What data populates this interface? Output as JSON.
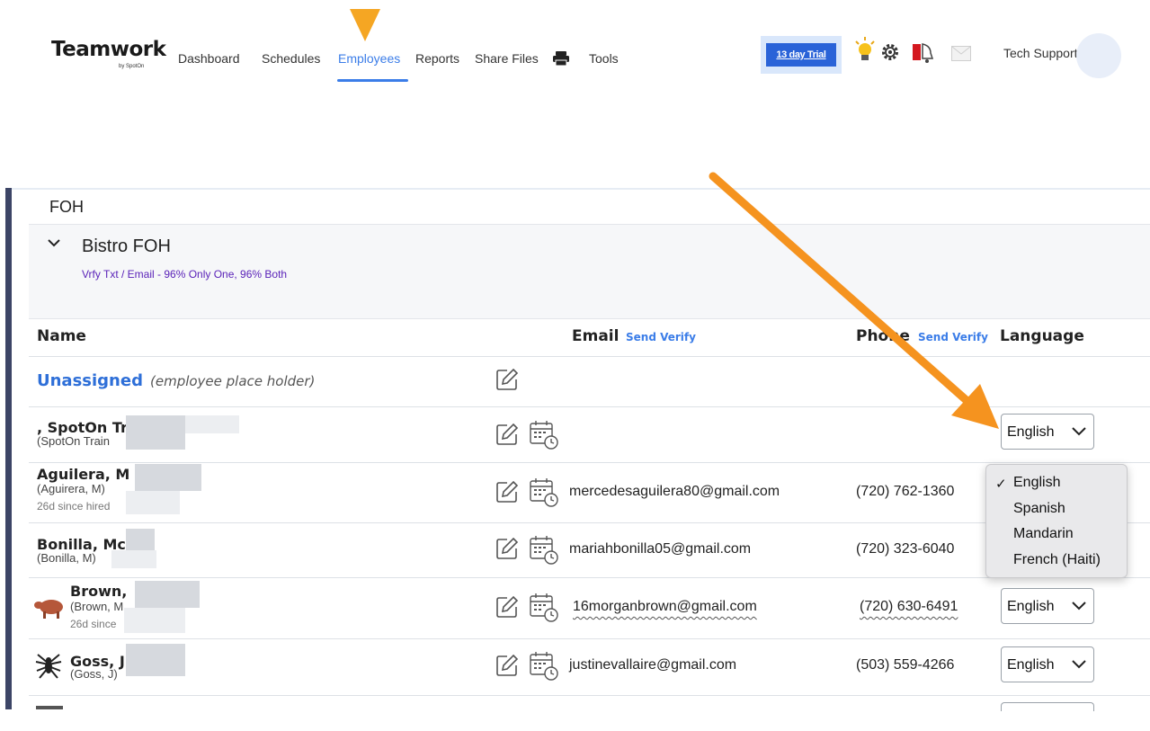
{
  "nav": {
    "logo_text": "Teamwork",
    "logo_sub": "by SpotOn",
    "links": [
      "Dashboard",
      "Schedules",
      "Employees",
      "Reports",
      "Share Files",
      "Tools"
    ],
    "active": "Employees",
    "trial_label": "13 day Trial",
    "support_label": "Tech Support"
  },
  "section": {
    "title": "FOH",
    "group_name": "Bistro FOH",
    "verify_summary": "Vrfy Txt / Email - 96% Only One, 96% Both"
  },
  "table": {
    "headers": {
      "name": "Name",
      "email": "Email",
      "email_action": "Send Verify",
      "phone": "Phone",
      "phone_action": "Send Verify",
      "language": "Language"
    },
    "unassigned": {
      "label": "Unassigned",
      "note": "(employee place holder)"
    },
    "rows": [
      {
        "name": ", SpotOn Tr",
        "sub": "(SpotOn Train",
        "hired": "",
        "email": "",
        "phone": "",
        "language": "English"
      },
      {
        "name": "Aguilera, M",
        "sub": "(Aguirera, M)",
        "hired": "26d since hired",
        "email": "mercedesaguilera80@gmail.com",
        "phone": "(720) 762-1360",
        "language": "English"
      },
      {
        "name": "Bonilla, Mc",
        "sub": "(Bonilla, M)",
        "hired": "",
        "email": "mariahbonilla05@gmail.com",
        "phone": "(720) 323-6040",
        "language": ""
      },
      {
        "name": "Brown,",
        "sub": "(Brown, M",
        "hired": "26d since",
        "email": "16morganbrown@gmail.com",
        "phone": "(720) 630-6491",
        "language": "English"
      },
      {
        "name": "Goss, J",
        "sub": "(Goss, J)",
        "hired": "",
        "email": "justinevallaire@gmail.com",
        "phone": "(503) 559-4266",
        "language": "English"
      }
    ]
  },
  "language_dropdown": {
    "selected": "English",
    "options": [
      "English",
      "Spanish",
      "Mandarin",
      "French (Haiti)"
    ]
  },
  "colors": {
    "accent": "#3b7de8",
    "annotation_arrow": "#f5931f",
    "caret": "#f5a623",
    "sidebar": "#3c4566"
  },
  "icons": [
    "printer-icon",
    "lightbulb-icon",
    "gear-icon",
    "bell-icon",
    "mail-icon",
    "chevron-down-icon",
    "edit-icon",
    "calendar-clock-icon",
    "cow-icon",
    "spider-icon"
  ]
}
